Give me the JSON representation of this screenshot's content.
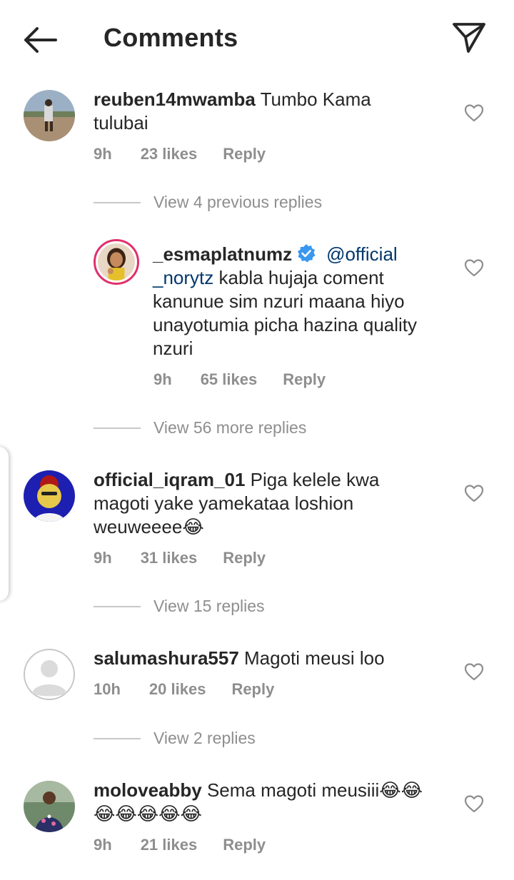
{
  "header": {
    "title": "Comments"
  },
  "comments": [
    {
      "username": "reuben14mwamba",
      "text": " Tumbo Kama tulubai",
      "time": "9h",
      "likes": "23 likes",
      "reply": "Reply",
      "view_replies": "View 4 previous replies"
    },
    {
      "username": "_esmaplatnumz",
      "mention": "@official _norytz",
      "text": " kabla hujaja coment kanunue sim nzuri maana hiyo unayotumia picha hazina quality nzuri",
      "time": "9h",
      "likes": "65 likes",
      "reply": "Reply",
      "view_replies": "View 56 more replies"
    },
    {
      "username": "official_iqram_01",
      "text": " Piga kelele kwa magoti yake yamekataa loshion weuweeee😂",
      "time": "9h",
      "likes": "31 likes",
      "reply": "Reply",
      "view_replies": "View 15 replies"
    },
    {
      "username": "salumashura557",
      "text": " Magoti meusi loo",
      "time": "10h",
      "likes": "20 likes",
      "reply": "Reply",
      "view_replies": "View 2 replies"
    },
    {
      "username": "moloveabby",
      "text": " Sema magoti meusiii😂😂 😂😂😂😂😂",
      "time": "9h",
      "likes": "21 likes",
      "reply": "Reply"
    }
  ]
}
